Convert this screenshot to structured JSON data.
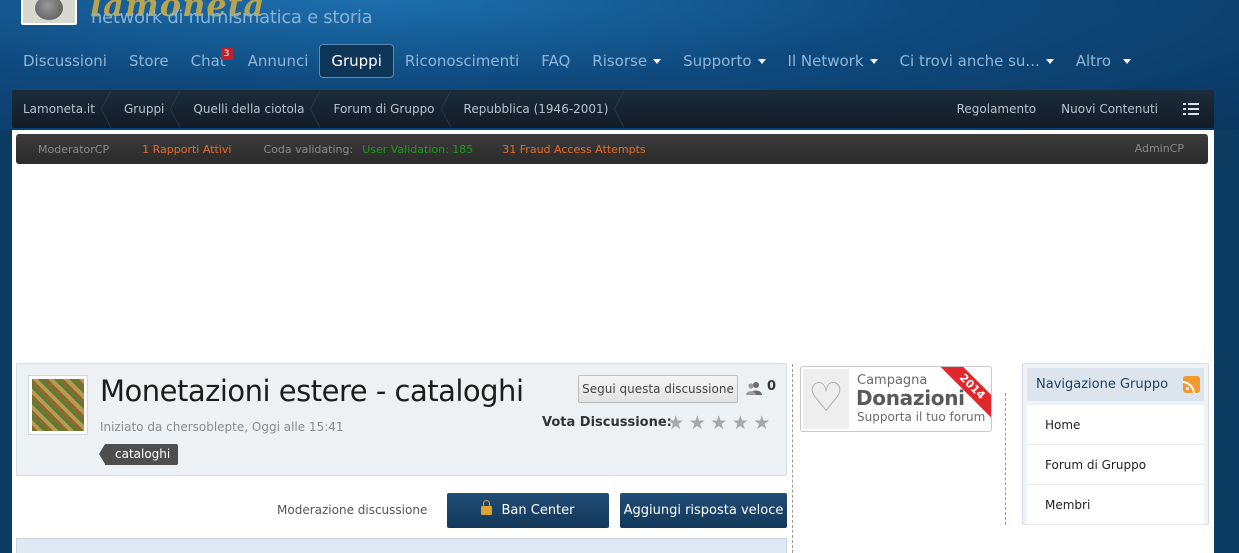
{
  "logo": {
    "tagline": "network di numismatica e storia",
    "wordmark": "lamoneta"
  },
  "nav": {
    "items": [
      {
        "label": "Discussioni"
      },
      {
        "label": "Store"
      },
      {
        "label": "Chat",
        "badge": "3"
      },
      {
        "label": "Annunci"
      },
      {
        "label": "Gruppi",
        "active": true
      },
      {
        "label": "Riconoscimenti"
      },
      {
        "label": "FAQ"
      },
      {
        "label": "Risorse",
        "dropdown": true
      },
      {
        "label": "Supporto",
        "dropdown": true
      },
      {
        "label": "Il Network",
        "dropdown": true
      },
      {
        "label": "Ci trovi anche su...",
        "dropdown": true
      },
      {
        "label": "Altro",
        "dropdown": true
      }
    ]
  },
  "breadcrumb": {
    "items": [
      "Lamoneta.it",
      "Gruppi",
      "Quelli della ciotola",
      "Forum di Gruppo",
      "Repubblica (1946-2001)"
    ],
    "right": [
      "Regolamento",
      "Nuovi Contenuti"
    ]
  },
  "modbar": {
    "moderatorcp": "ModeratorCP",
    "reports": "1 Rapporti Attivi",
    "validating_label": "Coda validating:",
    "validation": "User Validation: 185",
    "fraud": "31 Fraud Access Attempts",
    "admincp": "AdminCP"
  },
  "topic": {
    "title": "Monetazioni estere - cataloghi",
    "meta": "Iniziato da chersoblepte, Oggi alle 15:41",
    "tag": "cataloghi",
    "follow_label": "Segui questa discussione",
    "followers": "0",
    "rate_label": "Vota Discussione:",
    "rating_stars": 5
  },
  "actions": {
    "moderation_label": "Moderazione discussione",
    "ban_center": "Ban Center",
    "quick_reply": "Aggiungi risposta veloce"
  },
  "donation": {
    "line1": "Campagna",
    "line2": "Donazioni",
    "line3": "Supporta il tuo forum",
    "year": "2014"
  },
  "group_nav": {
    "title": "Navigazione Gruppo",
    "items": [
      "Home",
      "Forum di Gruppo",
      "Membri"
    ]
  },
  "colors": {
    "header_blue": "#0f4a7e",
    "button_blue": "#133859",
    "orange": "#e96b25",
    "green": "#1a9c1a",
    "ribbon_red": "#e0282a"
  }
}
